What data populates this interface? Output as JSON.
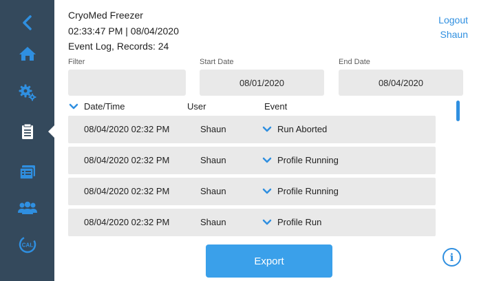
{
  "header": {
    "device_name": "CryoMed Freezer",
    "datetime": "02:33:47 PM | 08/04/2020",
    "subtitle": "Event Log, Records: 24"
  },
  "account": {
    "logout_label": "Logout",
    "user_name": "Shaun"
  },
  "filters": {
    "filter_label": "Filter",
    "filter_value": "",
    "start_label": "Start Date",
    "start_value": "08/01/2020",
    "end_label": "End Date",
    "end_value": "08/04/2020"
  },
  "table": {
    "headers": {
      "datetime": "Date/Time",
      "user": "User",
      "event": "Event"
    },
    "rows": [
      {
        "datetime": "08/04/2020 02:32 PM",
        "user": "Shaun",
        "event": "Run Aborted"
      },
      {
        "datetime": "08/04/2020 02:32 PM",
        "user": "Shaun",
        "event": "Profile Running"
      },
      {
        "datetime": "08/04/2020 02:32 PM",
        "user": "Shaun",
        "event": "Profile Running"
      },
      {
        "datetime": "08/04/2020 02:32 PM",
        "user": "Shaun",
        "event": "Profile Run"
      }
    ]
  },
  "actions": {
    "export_label": "Export",
    "info_symbol": "i"
  },
  "sidebar": {
    "items": [
      {
        "icon": "back-icon"
      },
      {
        "icon": "home-icon"
      },
      {
        "icon": "settings-icon"
      },
      {
        "icon": "clipboard-icon",
        "active": true
      },
      {
        "icon": "reports-icon"
      },
      {
        "icon": "users-icon"
      },
      {
        "icon": "calibration-icon",
        "label": "CAL"
      }
    ]
  },
  "colors": {
    "sidebar": "#34495c",
    "accent": "#2f8fe0",
    "button": "#3aa0ea",
    "field": "#e9e9e9"
  }
}
